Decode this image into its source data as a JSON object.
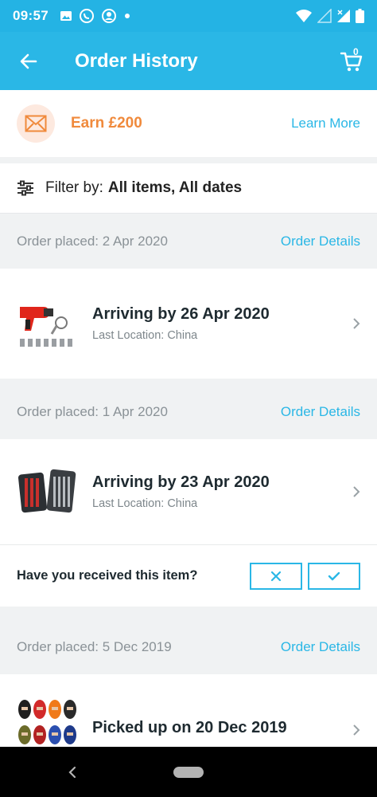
{
  "status_bar": {
    "time": "09:57",
    "left_icons": [
      "image-icon",
      "viber-icon",
      "app-icon",
      "dot-icon"
    ],
    "right_icons": [
      "wifi-icon",
      "signal-icon",
      "signal-x-icon",
      "battery-icon"
    ]
  },
  "app_bar": {
    "title": "Order History",
    "cart_count": "0"
  },
  "promo": {
    "text": "Earn £200",
    "link": "Learn More"
  },
  "filter": {
    "label": "Filter by:",
    "value": "All items, All dates"
  },
  "orders": [
    {
      "placed": "Order placed: 2 Apr 2020",
      "details_link": "Order Details",
      "item_title": "Arriving by 26 Apr 2020",
      "item_sub": "Last Location: China",
      "thumb": "heat-gun-product"
    },
    {
      "placed": "Order placed: 1 Apr 2020",
      "details_link": "Order Details",
      "item_title": "Arriving by 23 Apr 2020",
      "item_sub": "Last Location: China",
      "thumb": "screwdriver-set-product"
    },
    {
      "placed": "Order placed: 5 Dec 2019",
      "details_link": "Order Details",
      "item_title": "Picked up on 20 Dec 2019",
      "item_sub": "",
      "thumb": "balaclava-masks-product"
    }
  ],
  "received_prompt": {
    "question": "Have you received this item?",
    "no_icon": "close-icon",
    "yes_icon": "check-icon"
  },
  "colors": {
    "primary": "#2ab7e6",
    "accent_orange": "#f08a3c",
    "background": "#f0f2f3"
  }
}
